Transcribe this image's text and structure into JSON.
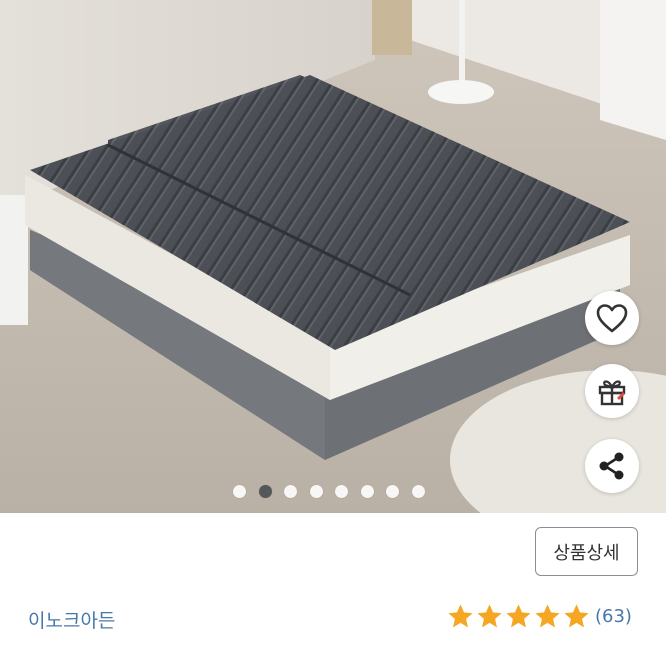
{
  "product": {
    "brand": "이노크아든",
    "rating": 5,
    "review_count": "(63)",
    "title_partial": ""
  },
  "actions": {
    "detail_button": "상품상세",
    "wishlist_icon": "heart-icon",
    "gift_icon": "gift-icon",
    "share_icon": "share-icon"
  },
  "gallery": {
    "total_images": 8,
    "active_index": 1
  },
  "colors": {
    "link_blue": "#4878a8",
    "star_orange": "#f5a623",
    "mat_gray": "#4a4d52"
  }
}
